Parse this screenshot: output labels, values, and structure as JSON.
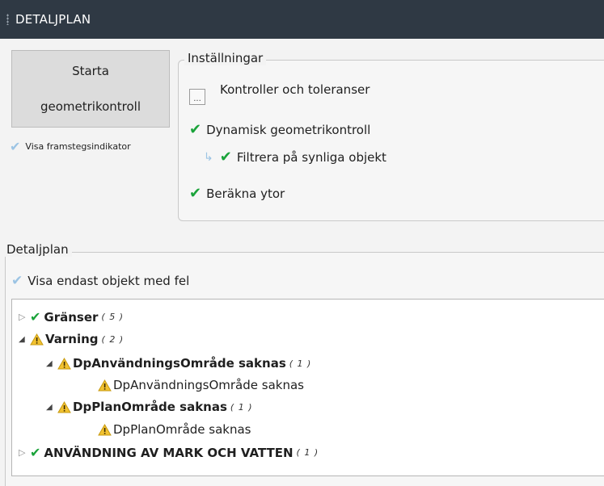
{
  "window": {
    "title": "DETALJPLAN"
  },
  "start_button": {
    "line1": "Starta",
    "line2": "geometrikontroll"
  },
  "progress_indicator": {
    "label": "Visa framstegsindikator"
  },
  "settings": {
    "legend": "Inställningar",
    "dots_label": "...",
    "controls_label": "Kontroller och toleranser",
    "dynamic_label": "Dynamisk geometrikontroll",
    "filter_label": "Filtrera på synliga objekt",
    "compute_label": "Beräkna ytor"
  },
  "detaljplan": {
    "legend": "Detaljplan",
    "only_errors_label": "Visa endast objekt med fel"
  },
  "tree": {
    "items": [
      {
        "label": "Gränser",
        "count": "( 5 )"
      },
      {
        "label": "Varning",
        "count": "( 2 )"
      },
      {
        "label": "DpAnvändningsOmråde saknas",
        "count": "( 1 )"
      },
      {
        "label": "DpAnvändningsOmråde saknas"
      },
      {
        "label": "DpPlanOmråde saknas",
        "count": "( 1 )"
      },
      {
        "label": "DpPlanOmråde saknas"
      },
      {
        "label": "ANVÄNDNING AV MARK OCH VATTEN",
        "count": "( 1 )"
      }
    ]
  },
  "colors": {
    "titlebar": "#2f3944",
    "check_green": "#1aa33a",
    "warning": "#f2c230"
  }
}
